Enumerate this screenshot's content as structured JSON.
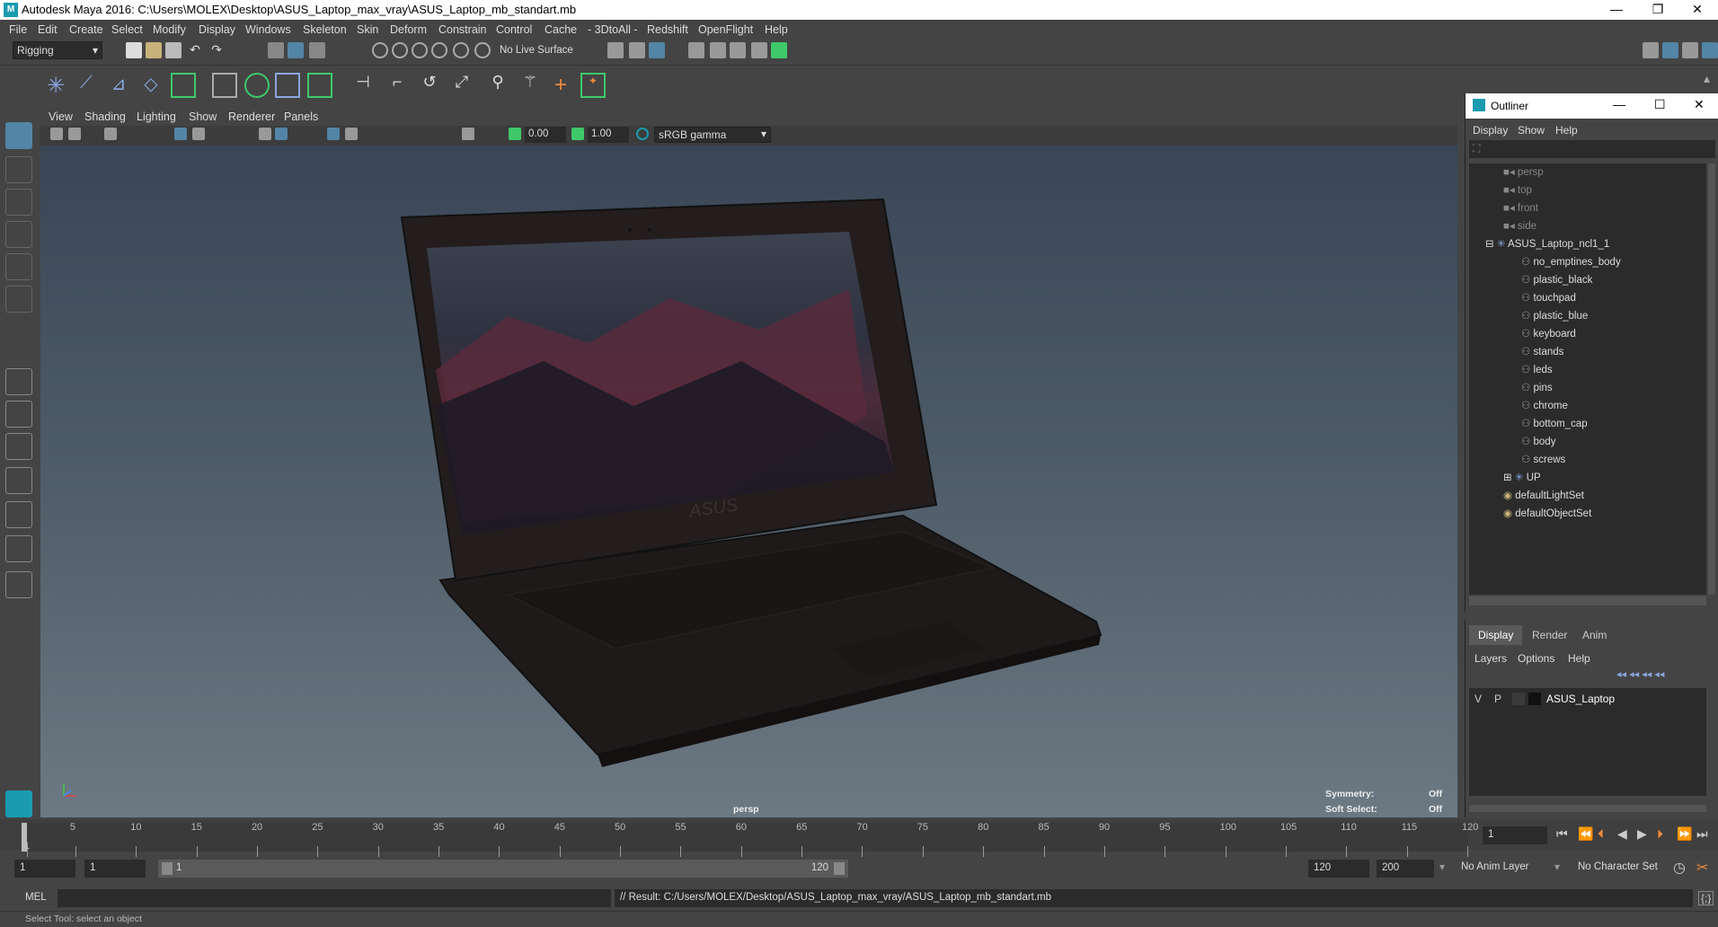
{
  "window": {
    "title": "Autodesk Maya 2016: C:\\Users\\MOLEX\\Desktop\\ASUS_Laptop_max_vray\\ASUS_Laptop_mb_standart.mb",
    "minimize": "—",
    "restore": "❐",
    "close": "✕"
  },
  "menubar": [
    "File",
    "Edit",
    "Create",
    "Select",
    "Modify",
    "Display",
    "Windows",
    "Skeleton",
    "Skin",
    "Deform",
    "Constrain",
    "Control",
    "Cache",
    "- 3DtoAll -",
    "Redshift",
    "OpenFlight",
    "Help"
  ],
  "statusline": {
    "mode": "Rigging",
    "live_surface": "No Live Surface"
  },
  "viewport": {
    "menus": [
      "View",
      "Shading",
      "Lighting",
      "Show",
      "Renderer",
      "Panels"
    ],
    "exposure": "0.00",
    "gamma": "1.00",
    "colorspace": "sRGB gamma",
    "camera_label": "persp",
    "hud_symmetry_label": "Symmetry:",
    "hud_symmetry_value": "Off",
    "hud_softselect_label": "Soft Select:",
    "hud_softselect_value": "Off",
    "screen_logo": "ASUS"
  },
  "outliner": {
    "title": "Outliner",
    "menus": [
      "Display",
      "Show",
      "Help"
    ],
    "cameras": [
      "persp",
      "top",
      "front",
      "side"
    ],
    "group": "ASUS_Laptop_ncl1_1",
    "children": [
      "no_emptines_body",
      "plastic_black",
      "touchpad",
      "plastic_blue",
      "keyboard",
      "stands",
      "leds",
      "pins",
      "chrome",
      "bottom_cap",
      "body",
      "screws",
      "UP"
    ],
    "sets": [
      "defaultLightSet",
      "defaultObjectSet"
    ]
  },
  "layer_editor": {
    "tabs": [
      "Display",
      "Render",
      "Anim"
    ],
    "menus": [
      "Layers",
      "Options",
      "Help"
    ],
    "layer_v": "V",
    "layer_p": "P",
    "layer_name": "ASUS_Laptop"
  },
  "timeline": {
    "ticks": [
      1,
      5,
      10,
      15,
      20,
      25,
      30,
      35,
      40,
      45,
      50,
      55,
      60,
      65,
      70,
      75,
      80,
      85,
      90,
      95,
      100,
      105,
      110,
      115,
      120
    ],
    "current_frame": "1"
  },
  "range": {
    "start": "1",
    "playback_start": "1",
    "slider_start": "1",
    "slider_end": "120",
    "playback_end": "120",
    "end": "200",
    "anim_layer": "No Anim Layer",
    "character_set": "No Character Set"
  },
  "cmdline": {
    "lang": "MEL",
    "result": "// Result: C:/Users/MOLEX/Desktop/ASUS_Laptop_max_vray/ASUS_Laptop_mb_standart.mb"
  },
  "helpline": "Select Tool: select an object",
  "colors": {
    "accent": "#5285a6",
    "green_icon": "#3fc96a",
    "ui_bg": "#444444"
  }
}
